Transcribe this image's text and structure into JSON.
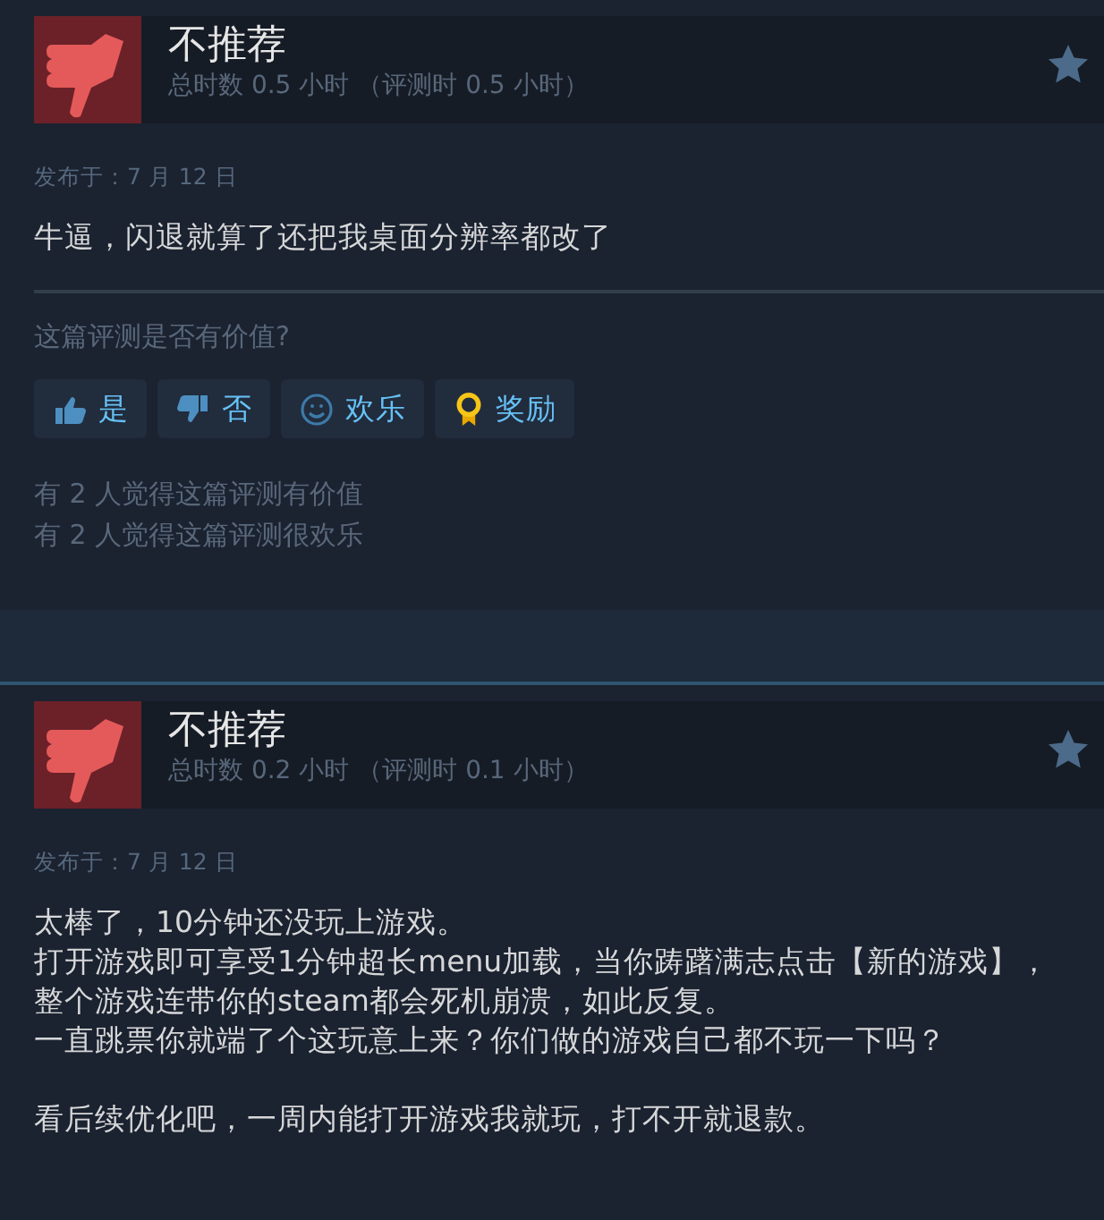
{
  "reviews": [
    {
      "verdict": "不推荐",
      "recommended": false,
      "hours": "总时数 0.5 小时 （评测时 0.5 小时）",
      "posted": "发布于：7 月 12 日",
      "paragraphs": [
        [
          "牛逼，闪退就算了还把我桌面分辨率都改了"
        ]
      ],
      "prompt": "这篇评测是否有价值?",
      "votes": [
        {
          "kind": "up",
          "label": "是"
        },
        {
          "kind": "down",
          "label": "否"
        },
        {
          "kind": "funny",
          "label": "欢乐"
        },
        {
          "kind": "award",
          "label": "奖励"
        }
      ],
      "tallies": [
        "有 2 人觉得这篇评测有价值",
        "有 2 人觉得这篇评测很欢乐"
      ]
    },
    {
      "verdict": "不推荐",
      "recommended": false,
      "hours": "总时数 0.2 小时 （评测时 0.1 小时）",
      "posted": "发布于：7 月 12 日",
      "paragraphs": [
        [
          "太棒了，10分钟还没玩上游戏。",
          "打开游戏即可享受1分钟超长menu加载，当你踌躇满志点击【新的游戏】，整个游戏连带你的steam都会死机崩溃，如此反复。",
          "一直跳票你就端了个这玩意上来？你们做的游戏自己都不玩一下吗？"
        ],
        [
          "看后续优化吧，一周内能打开游戏我就玩，打不开就退款。"
        ]
      ]
    }
  ]
}
